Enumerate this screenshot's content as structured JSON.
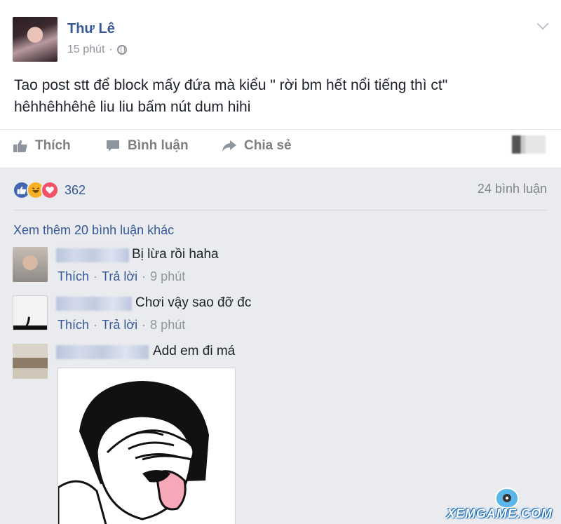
{
  "post": {
    "author": "Thư Lê",
    "time": "15 phút",
    "time_separator": "·",
    "text_line1": "Tao post stt để block mấy đứa mà kiểu \" rời bm hết nổi tiếng thì ct\"",
    "text_line2": "hêhhêhhêhê liu liu bấm nút dum hihi"
  },
  "actions": {
    "like": "Thích",
    "comment": "Bình luận",
    "share": "Chia sẻ"
  },
  "reactions": {
    "count": "362",
    "comments_count": "24 bình luận",
    "types": [
      "like-icon",
      "haha-icon",
      "love-icon"
    ]
  },
  "comments_section": {
    "view_more": "Xem thêm 20 bình luận khác"
  },
  "comments": [
    {
      "text": "Bị lừa rồi haha",
      "like": "Thích",
      "reply": "Trả lời",
      "separator": "·",
      "time": "9 phút"
    },
    {
      "text": "Chơi vậy sao đỡ đc",
      "like": "Thích",
      "reply": "Trả lời",
      "separator": "·",
      "time": "8 phút"
    },
    {
      "text": "Add em đi má"
    }
  ],
  "watermark": "XEMGAME.COM",
  "colors": {
    "link": "#365899",
    "muted": "#90949c",
    "background": "#e9ebee",
    "like": "#4267b2",
    "haha": "#f7b125",
    "love": "#f25268"
  }
}
